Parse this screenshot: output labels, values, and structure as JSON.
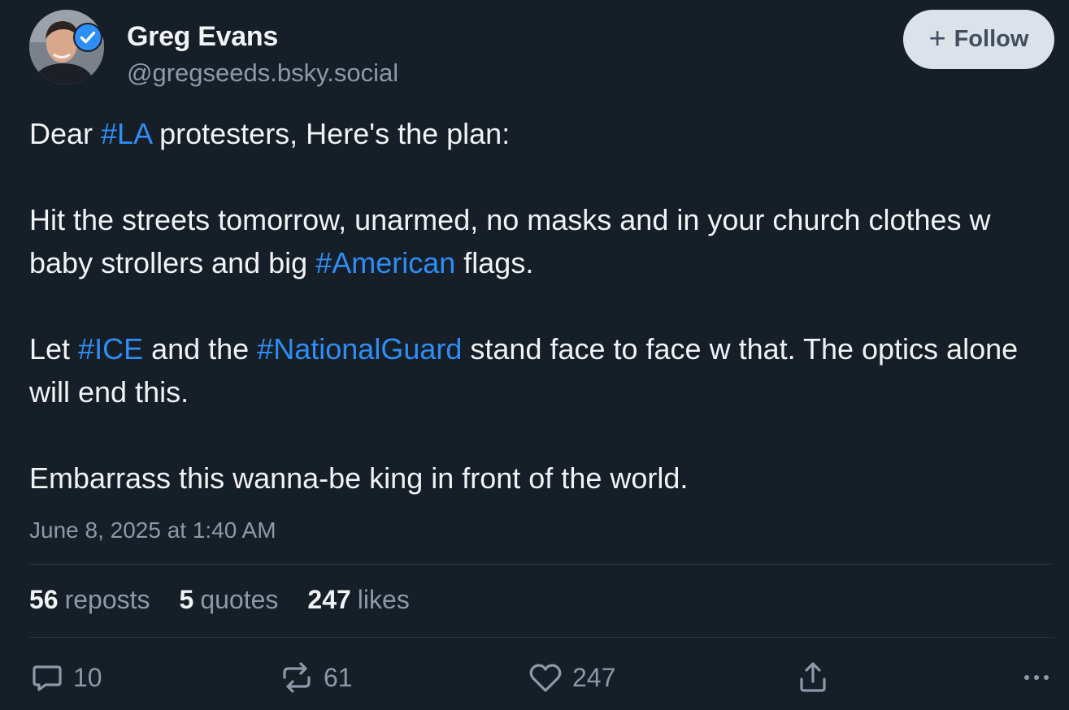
{
  "author": {
    "name": "Greg Evans",
    "handle": "@gregseeds.bsky.social",
    "verified": true
  },
  "follow_button": {
    "label": "Follow"
  },
  "post": {
    "p1": {
      "a": "Dear ",
      "tag1": "#LA",
      "b": " protesters, Here's the plan:"
    },
    "p2": {
      "a": "Hit the streets tomorrow, unarmed, no masks and in your church clothes w baby strollers and big ",
      "tag1": "#American",
      "b": " flags."
    },
    "p3": {
      "a": "Let ",
      "tag1": "#ICE",
      "b": " and the ",
      "tag2": "#NationalGuard",
      "c": " stand face to face w that. The optics alone will end this."
    },
    "p4": {
      "a": "Embarrass this wanna-be king in front of the world."
    },
    "timestamp": "June 8, 2025 at 1:40 AM"
  },
  "stats": {
    "reposts_count": "56",
    "reposts_label": "reposts",
    "quotes_count": "5",
    "quotes_label": "quotes",
    "likes_count": "247",
    "likes_label": "likes"
  },
  "actions": {
    "reply_count": "10",
    "repost_count": "61",
    "like_count": "247"
  },
  "colors": {
    "background": "#161e27",
    "hashtag": "#2e8ef5",
    "muted": "#8d99a8",
    "follow_bg": "#dce2ea",
    "verified": "#2e8ef5"
  },
  "icons": [
    "checkmark-badge-icon",
    "plus-icon",
    "reply-bubble-icon",
    "repost-icon",
    "heart-icon",
    "share-icon",
    "more-dots-icon"
  ]
}
